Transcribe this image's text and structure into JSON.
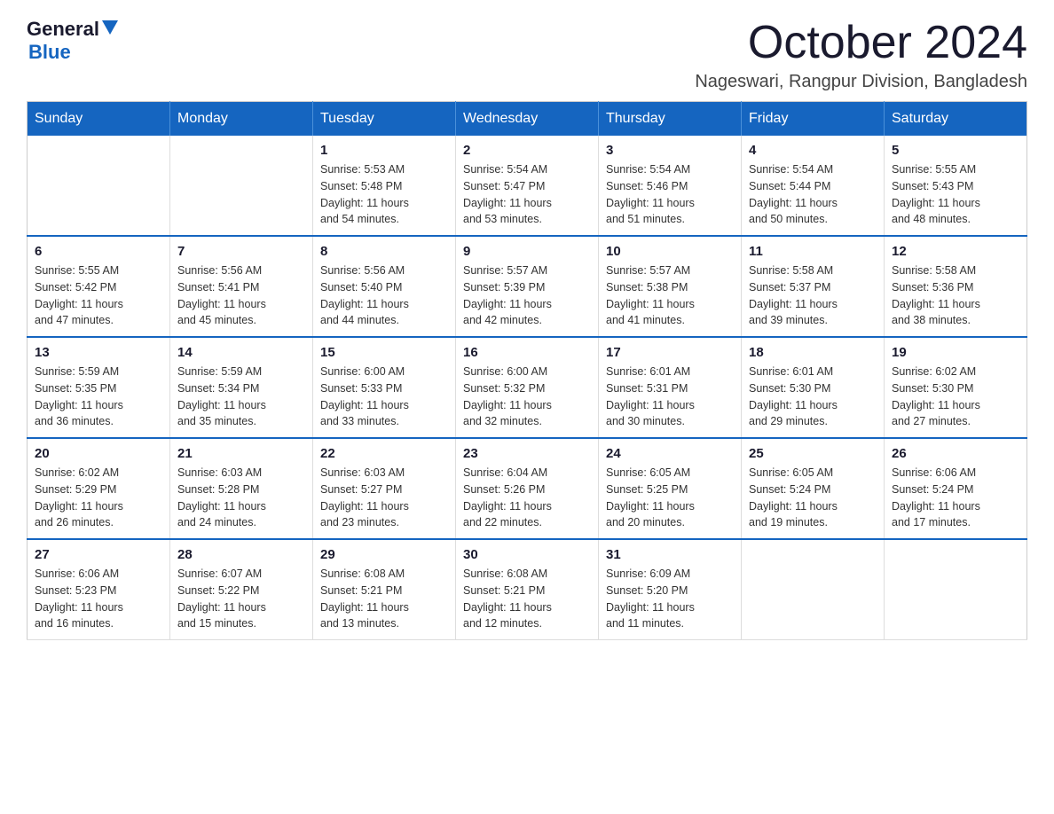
{
  "logo": {
    "text_general": "General",
    "text_blue": "Blue"
  },
  "title": "October 2024",
  "subtitle": "Nageswari, Rangpur Division, Bangladesh",
  "days_header": [
    "Sunday",
    "Monday",
    "Tuesday",
    "Wednesday",
    "Thursday",
    "Friday",
    "Saturday"
  ],
  "weeks": [
    [
      {
        "day": "",
        "info": ""
      },
      {
        "day": "",
        "info": ""
      },
      {
        "day": "1",
        "info": "Sunrise: 5:53 AM\nSunset: 5:48 PM\nDaylight: 11 hours\nand 54 minutes."
      },
      {
        "day": "2",
        "info": "Sunrise: 5:54 AM\nSunset: 5:47 PM\nDaylight: 11 hours\nand 53 minutes."
      },
      {
        "day": "3",
        "info": "Sunrise: 5:54 AM\nSunset: 5:46 PM\nDaylight: 11 hours\nand 51 minutes."
      },
      {
        "day": "4",
        "info": "Sunrise: 5:54 AM\nSunset: 5:44 PM\nDaylight: 11 hours\nand 50 minutes."
      },
      {
        "day": "5",
        "info": "Sunrise: 5:55 AM\nSunset: 5:43 PM\nDaylight: 11 hours\nand 48 minutes."
      }
    ],
    [
      {
        "day": "6",
        "info": "Sunrise: 5:55 AM\nSunset: 5:42 PM\nDaylight: 11 hours\nand 47 minutes."
      },
      {
        "day": "7",
        "info": "Sunrise: 5:56 AM\nSunset: 5:41 PM\nDaylight: 11 hours\nand 45 minutes."
      },
      {
        "day": "8",
        "info": "Sunrise: 5:56 AM\nSunset: 5:40 PM\nDaylight: 11 hours\nand 44 minutes."
      },
      {
        "day": "9",
        "info": "Sunrise: 5:57 AM\nSunset: 5:39 PM\nDaylight: 11 hours\nand 42 minutes."
      },
      {
        "day": "10",
        "info": "Sunrise: 5:57 AM\nSunset: 5:38 PM\nDaylight: 11 hours\nand 41 minutes."
      },
      {
        "day": "11",
        "info": "Sunrise: 5:58 AM\nSunset: 5:37 PM\nDaylight: 11 hours\nand 39 minutes."
      },
      {
        "day": "12",
        "info": "Sunrise: 5:58 AM\nSunset: 5:36 PM\nDaylight: 11 hours\nand 38 minutes."
      }
    ],
    [
      {
        "day": "13",
        "info": "Sunrise: 5:59 AM\nSunset: 5:35 PM\nDaylight: 11 hours\nand 36 minutes."
      },
      {
        "day": "14",
        "info": "Sunrise: 5:59 AM\nSunset: 5:34 PM\nDaylight: 11 hours\nand 35 minutes."
      },
      {
        "day": "15",
        "info": "Sunrise: 6:00 AM\nSunset: 5:33 PM\nDaylight: 11 hours\nand 33 minutes."
      },
      {
        "day": "16",
        "info": "Sunrise: 6:00 AM\nSunset: 5:32 PM\nDaylight: 11 hours\nand 32 minutes."
      },
      {
        "day": "17",
        "info": "Sunrise: 6:01 AM\nSunset: 5:31 PM\nDaylight: 11 hours\nand 30 minutes."
      },
      {
        "day": "18",
        "info": "Sunrise: 6:01 AM\nSunset: 5:30 PM\nDaylight: 11 hours\nand 29 minutes."
      },
      {
        "day": "19",
        "info": "Sunrise: 6:02 AM\nSunset: 5:30 PM\nDaylight: 11 hours\nand 27 minutes."
      }
    ],
    [
      {
        "day": "20",
        "info": "Sunrise: 6:02 AM\nSunset: 5:29 PM\nDaylight: 11 hours\nand 26 minutes."
      },
      {
        "day": "21",
        "info": "Sunrise: 6:03 AM\nSunset: 5:28 PM\nDaylight: 11 hours\nand 24 minutes."
      },
      {
        "day": "22",
        "info": "Sunrise: 6:03 AM\nSunset: 5:27 PM\nDaylight: 11 hours\nand 23 minutes."
      },
      {
        "day": "23",
        "info": "Sunrise: 6:04 AM\nSunset: 5:26 PM\nDaylight: 11 hours\nand 22 minutes."
      },
      {
        "day": "24",
        "info": "Sunrise: 6:05 AM\nSunset: 5:25 PM\nDaylight: 11 hours\nand 20 minutes."
      },
      {
        "day": "25",
        "info": "Sunrise: 6:05 AM\nSunset: 5:24 PM\nDaylight: 11 hours\nand 19 minutes."
      },
      {
        "day": "26",
        "info": "Sunrise: 6:06 AM\nSunset: 5:24 PM\nDaylight: 11 hours\nand 17 minutes."
      }
    ],
    [
      {
        "day": "27",
        "info": "Sunrise: 6:06 AM\nSunset: 5:23 PM\nDaylight: 11 hours\nand 16 minutes."
      },
      {
        "day": "28",
        "info": "Sunrise: 6:07 AM\nSunset: 5:22 PM\nDaylight: 11 hours\nand 15 minutes."
      },
      {
        "day": "29",
        "info": "Sunrise: 6:08 AM\nSunset: 5:21 PM\nDaylight: 11 hours\nand 13 minutes."
      },
      {
        "day": "30",
        "info": "Sunrise: 6:08 AM\nSunset: 5:21 PM\nDaylight: 11 hours\nand 12 minutes."
      },
      {
        "day": "31",
        "info": "Sunrise: 6:09 AM\nSunset: 5:20 PM\nDaylight: 11 hours\nand 11 minutes."
      },
      {
        "day": "",
        "info": ""
      },
      {
        "day": "",
        "info": ""
      }
    ]
  ]
}
